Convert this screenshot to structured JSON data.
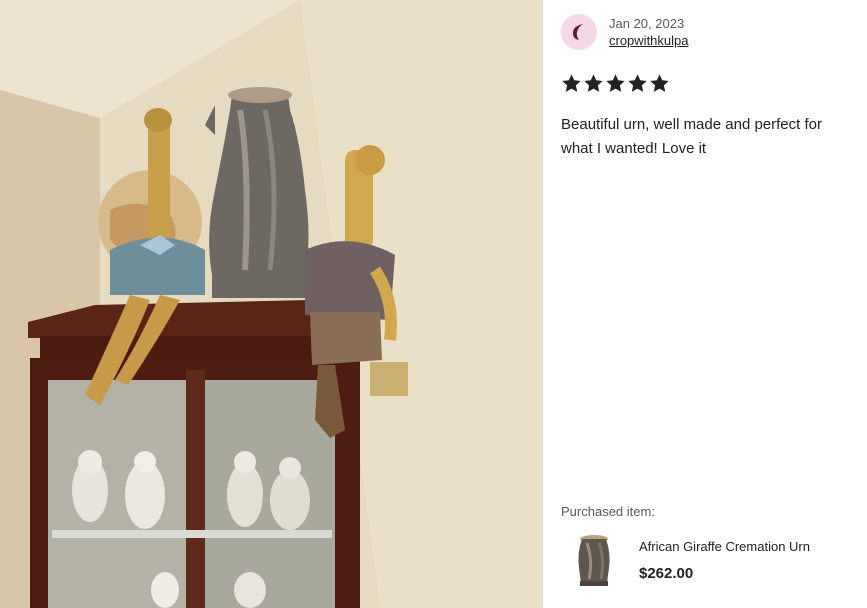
{
  "review": {
    "date": "Jan 20, 2023",
    "username": "cropwithkulpa",
    "rating": 5,
    "text_lines": [
      "Beautiful urn, well made and perfect for",
      "what I wanted! Love it"
    ]
  },
  "purchased": {
    "label": "Purchased item:",
    "title": "African Giraffe Cremation Urn",
    "price": "$262.00"
  },
  "icons": {
    "avatar": "avatar-icon",
    "star": "star-icon"
  },
  "colors": {
    "avatar_bg": "#f6d7e6",
    "avatar_glyph": "#5c1a3a",
    "star": "#222222"
  }
}
